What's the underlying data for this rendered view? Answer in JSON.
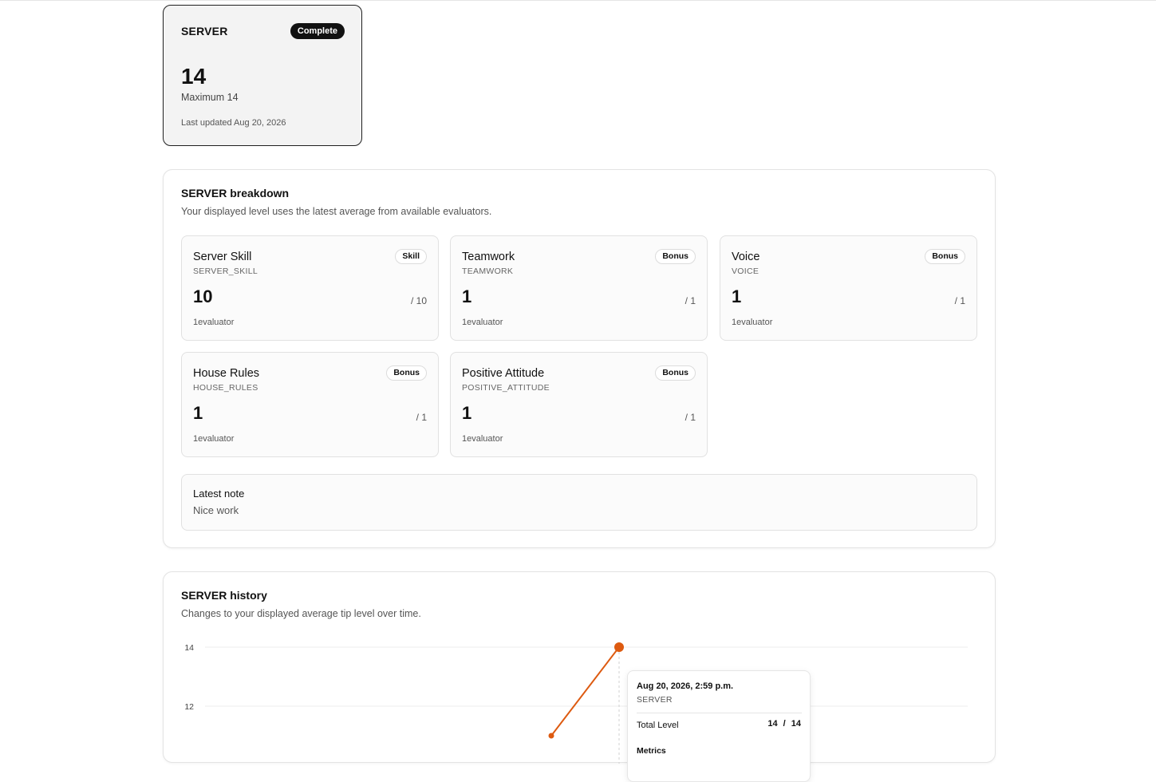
{
  "summary": {
    "title": "SERVER",
    "status_badge": "Complete",
    "value": "14",
    "maximum": "Maximum 14",
    "last_updated": "Last updated Aug 20, 2026"
  },
  "breakdown": {
    "title": "SERVER breakdown",
    "subtitle": "Your displayed level uses the latest average from available evaluators.",
    "metrics": [
      {
        "name": "Server Skill",
        "code": "SERVER_SKILL",
        "tag": "Skill",
        "value": "10",
        "max": "/ 10",
        "evaluators": "1evaluator"
      },
      {
        "name": "Teamwork",
        "code": "TEAMWORK",
        "tag": "Bonus",
        "value": "1",
        "max": "/ 1",
        "evaluators": "1evaluator"
      },
      {
        "name": "Voice",
        "code": "VOICE",
        "tag": "Bonus",
        "value": "1",
        "max": "/ 1",
        "evaluators": "1evaluator"
      },
      {
        "name": "House Rules",
        "code": "HOUSE_RULES",
        "tag": "Bonus",
        "value": "1",
        "max": "/ 1",
        "evaluators": "1evaluator"
      },
      {
        "name": "Positive Attitude",
        "code": "POSITIVE_ATTITUDE",
        "tag": "Bonus",
        "value": "1",
        "max": "/ 1",
        "evaluators": "1evaluator"
      }
    ],
    "note": {
      "label": "Latest note",
      "text": "Nice work"
    }
  },
  "history": {
    "title": "SERVER history",
    "subtitle": "Changes to your displayed average tip level over time.",
    "tooltip": {
      "date": "Aug 20, 2026, 2:59 p.m.",
      "category": "SERVER",
      "row_label": "Total Level",
      "row_value": "14 / 14",
      "metrics_label": "Metrics"
    }
  },
  "chart_data": {
    "type": "line",
    "y_ticks": [
      "14",
      "12"
    ],
    "ylim": [
      10,
      14
    ],
    "points": [
      {
        "y": 11
      },
      {
        "y": 14
      }
    ],
    "line_color": "#dd5a10",
    "grid": true
  }
}
